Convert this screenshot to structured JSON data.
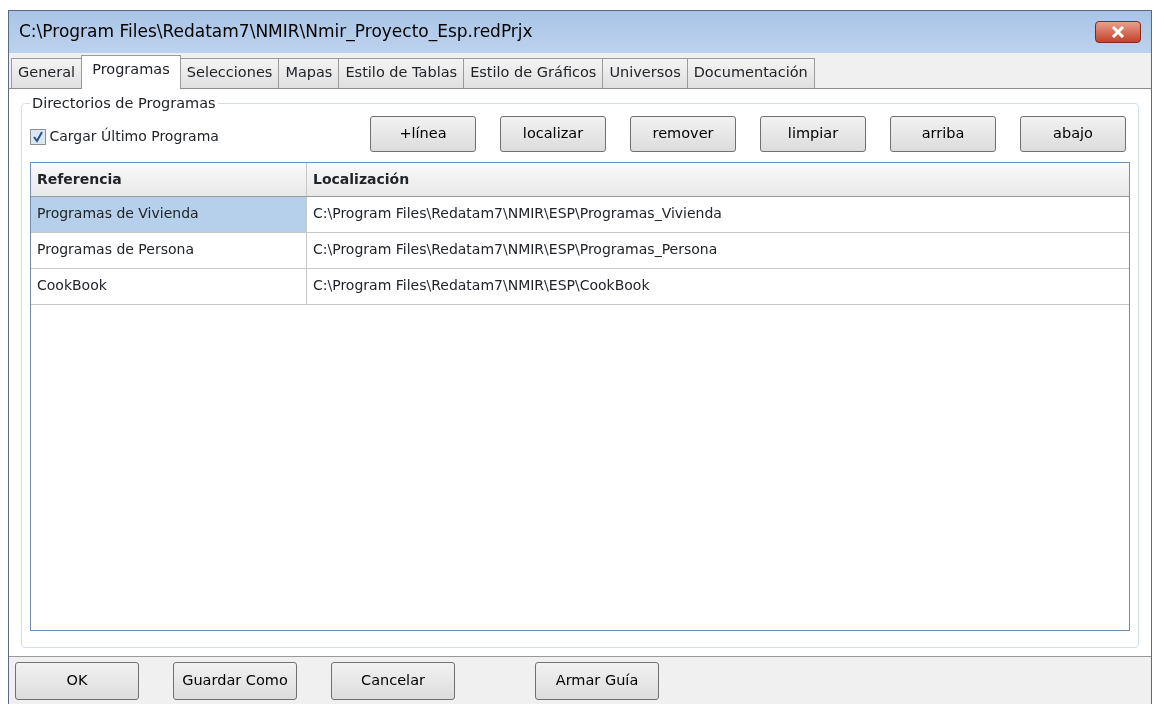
{
  "window": {
    "title": "C:\\Program Files\\Redatam7\\NMIR\\Nmir_Proyecto_Esp.redPrjx"
  },
  "tabs": [
    {
      "label": "General",
      "selected": false
    },
    {
      "label": "Programas",
      "selected": true
    },
    {
      "label": "Selecciones",
      "selected": false
    },
    {
      "label": "Mapas",
      "selected": false
    },
    {
      "label": "Estilo de Tablas",
      "selected": false
    },
    {
      "label": "Estilo de Gráficos",
      "selected": false
    },
    {
      "label": "Universos",
      "selected": false
    },
    {
      "label": "Documentación",
      "selected": false
    }
  ],
  "group": {
    "title": "Directorios de Programas",
    "checkbox": {
      "label": "Cargar Último Programa",
      "checked": true
    },
    "buttons": [
      "+línea",
      "localizar",
      "remover",
      "limpiar",
      "arriba",
      "abajo"
    ]
  },
  "table": {
    "columns": [
      "Referencia",
      "Localización"
    ],
    "rows": [
      {
        "cells": [
          "Programas de Vivienda",
          "C:\\Program Files\\Redatam7\\NMIR\\ESP\\Programas_Vivienda"
        ],
        "selected": true
      },
      {
        "cells": [
          "Programas de Persona",
          "C:\\Program Files\\Redatam7\\NMIR\\ESP\\Programas_Persona"
        ],
        "selected": false
      },
      {
        "cells": [
          "CookBook",
          "C:\\Program Files\\Redatam7\\NMIR\\ESP\\CookBook"
        ],
        "selected": false
      }
    ]
  },
  "footer_buttons": [
    "OK",
    "Guardar Como",
    "Cancelar",
    "Armar Guía"
  ]
}
